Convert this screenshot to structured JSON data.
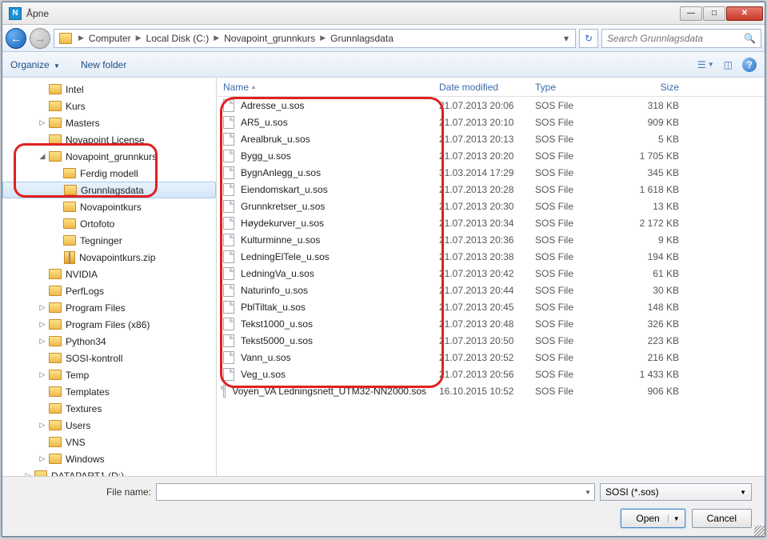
{
  "title": "Åpne",
  "breadcrumb": [
    "Computer",
    "Local Disk (C:)",
    "Novapoint_grunnkurs",
    "Grunnlagsdata"
  ],
  "search_placeholder": "Search Grunnlagsdata",
  "toolbar": {
    "organize": "Organize",
    "new_folder": "New folder"
  },
  "columns": {
    "name": "Name",
    "date": "Date modified",
    "type": "Type",
    "size": "Size"
  },
  "tree": [
    {
      "ind": 2,
      "label": "Intel",
      "exp": ""
    },
    {
      "ind": 2,
      "label": "Kurs",
      "exp": ""
    },
    {
      "ind": 2,
      "label": "Masters",
      "exp": "▷"
    },
    {
      "ind": 2,
      "label": "Novapoint License",
      "exp": ""
    },
    {
      "ind": 2,
      "label": "Novapoint_grunnkurs",
      "exp": "◢"
    },
    {
      "ind": 3,
      "label": "Ferdig modell",
      "exp": ""
    },
    {
      "ind": 3,
      "label": "Grunnlagsdata",
      "exp": "",
      "selected": true
    },
    {
      "ind": 3,
      "label": "Novapointkurs",
      "exp": ""
    },
    {
      "ind": 3,
      "label": "Ortofoto",
      "exp": ""
    },
    {
      "ind": 3,
      "label": "Tegninger",
      "exp": ""
    },
    {
      "ind": 3,
      "label": "Novapointkurs.zip",
      "exp": "",
      "zip": true
    },
    {
      "ind": 2,
      "label": "NVIDIA",
      "exp": ""
    },
    {
      "ind": 2,
      "label": "PerfLogs",
      "exp": ""
    },
    {
      "ind": 2,
      "label": "Program Files",
      "exp": "▷"
    },
    {
      "ind": 2,
      "label": "Program Files (x86)",
      "exp": "▷"
    },
    {
      "ind": 2,
      "label": "Python34",
      "exp": "▷"
    },
    {
      "ind": 2,
      "label": "SOSI-kontroll",
      "exp": ""
    },
    {
      "ind": 2,
      "label": "Temp",
      "exp": "▷"
    },
    {
      "ind": 2,
      "label": "Templates",
      "exp": ""
    },
    {
      "ind": 2,
      "label": "Textures",
      "exp": ""
    },
    {
      "ind": 2,
      "label": "Users",
      "exp": "▷"
    },
    {
      "ind": 2,
      "label": "VNS",
      "exp": ""
    },
    {
      "ind": 2,
      "label": "Windows",
      "exp": "▷"
    },
    {
      "ind": 1,
      "label": "DATAPART1 (D:)",
      "exp": "▷",
      "disk": true
    }
  ],
  "files": [
    {
      "name": "Adresse_u.sos",
      "date": "21.07.2013 20:06",
      "type": "SOS File",
      "size": "318 KB"
    },
    {
      "name": "AR5_u.sos",
      "date": "21.07.2013 20:10",
      "type": "SOS File",
      "size": "909 KB"
    },
    {
      "name": "Arealbruk_u.sos",
      "date": "21.07.2013 20:13",
      "type": "SOS File",
      "size": "5 KB"
    },
    {
      "name": "Bygg_u.sos",
      "date": "21.07.2013 20:20",
      "type": "SOS File",
      "size": "1 705 KB"
    },
    {
      "name": "BygnAnlegg_u.sos",
      "date": "31.03.2014 17:29",
      "type": "SOS File",
      "size": "345 KB"
    },
    {
      "name": "Eiendomskart_u.sos",
      "date": "21.07.2013 20:28",
      "type": "SOS File",
      "size": "1 618 KB"
    },
    {
      "name": "Grunnkretser_u.sos",
      "date": "21.07.2013 20:30",
      "type": "SOS File",
      "size": "13 KB"
    },
    {
      "name": "Høydekurver_u.sos",
      "date": "21.07.2013 20:34",
      "type": "SOS File",
      "size": "2 172 KB"
    },
    {
      "name": "Kulturminne_u.sos",
      "date": "21.07.2013 20:36",
      "type": "SOS File",
      "size": "9 KB"
    },
    {
      "name": "LedningElTele_u.sos",
      "date": "21.07.2013 20:38",
      "type": "SOS File",
      "size": "194 KB"
    },
    {
      "name": "LedningVa_u.sos",
      "date": "21.07.2013 20:42",
      "type": "SOS File",
      "size": "61 KB"
    },
    {
      "name": "Naturinfo_u.sos",
      "date": "21.07.2013 20:44",
      "type": "SOS File",
      "size": "30 KB"
    },
    {
      "name": "PblTiltak_u.sos",
      "date": "21.07.2013 20:45",
      "type": "SOS File",
      "size": "148 KB"
    },
    {
      "name": "Tekst1000_u.sos",
      "date": "21.07.2013 20:48",
      "type": "SOS File",
      "size": "326 KB"
    },
    {
      "name": "Tekst5000_u.sos",
      "date": "21.07.2013 20:50",
      "type": "SOS File",
      "size": "223 KB"
    },
    {
      "name": "Vann_u.sos",
      "date": "21.07.2013 20:52",
      "type": "SOS File",
      "size": "216 KB"
    },
    {
      "name": "Veg_u.sos",
      "date": "21.07.2013 20:56",
      "type": "SOS File",
      "size": "1 433 KB"
    },
    {
      "name": "Voyen_VA Ledningsnett_UTM32-NN2000.sos",
      "date": "16.10.2015 10:52",
      "type": "SOS File",
      "size": "906 KB"
    }
  ],
  "bottom": {
    "filename_label": "File name:",
    "filter": "SOSI (*.sos)",
    "open": "Open",
    "cancel": "Cancel"
  }
}
